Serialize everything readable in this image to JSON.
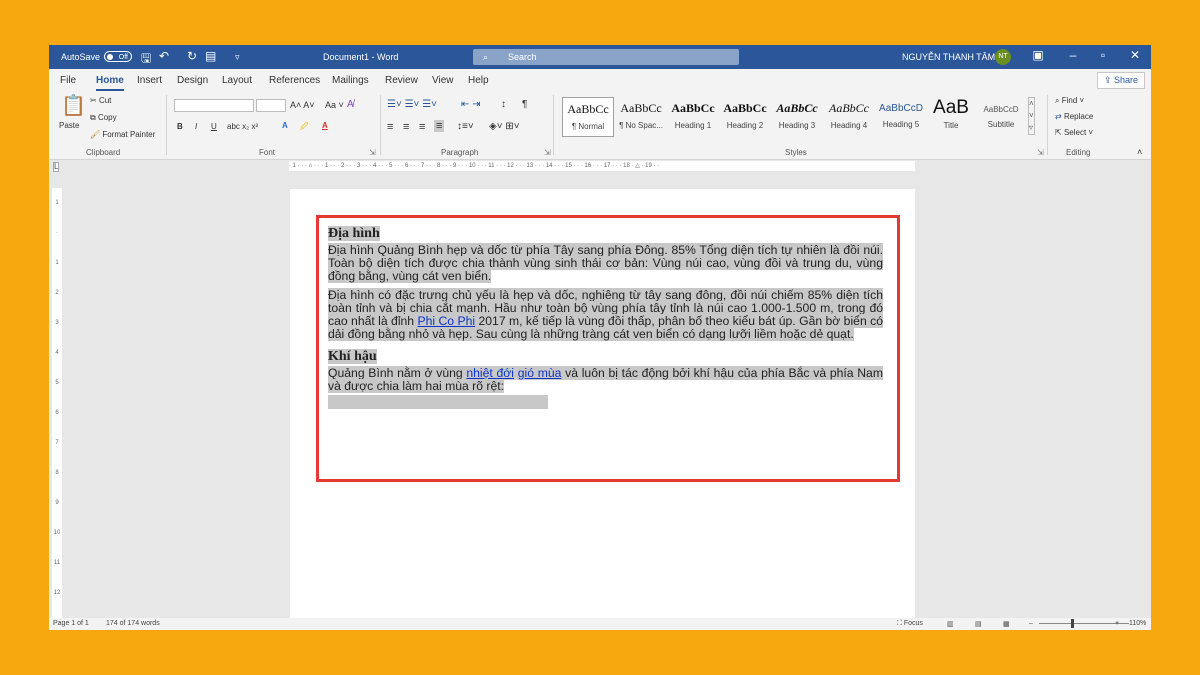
{
  "titlebar": {
    "autosave": "AutoSave",
    "autosave_state": "Off",
    "doc_title": "Document1  -  Word",
    "search_placeholder": "Search",
    "user_name": "NGUYỄN THANH TÂM",
    "user_initials": "NT"
  },
  "tabs": [
    "File",
    "Home",
    "Insert",
    "Design",
    "Layout",
    "References",
    "Mailings",
    "Review",
    "View",
    "Help"
  ],
  "share_label": "Share",
  "clipboard": {
    "paste": "Paste",
    "cut": "Cut",
    "copy": "Copy",
    "format_painter": "Format Painter",
    "group": "Clipboard"
  },
  "font": {
    "group": "Font",
    "bold": "B",
    "italic": "I",
    "underline": "U"
  },
  "paragraph": {
    "group": "Paragraph"
  },
  "styles": {
    "group": "Styles",
    "items": [
      {
        "preview": "AaBbCc",
        "name": "¶ Normal"
      },
      {
        "preview": "AaBbCc",
        "name": "¶ No Spac..."
      },
      {
        "preview": "AaBbCc",
        "name": "Heading 1"
      },
      {
        "preview": "AaBbCc",
        "name": "Heading 2"
      },
      {
        "preview": "AaBbCc",
        "name": "Heading 3"
      },
      {
        "preview": "AaBbCc",
        "name": "Heading 4"
      },
      {
        "preview": "AaBbCcD",
        "name": "Heading 5"
      },
      {
        "preview": "AaB",
        "name": "Title"
      },
      {
        "preview": "AaBbCcD",
        "name": "Subtitle"
      }
    ]
  },
  "editing": {
    "find": "Find",
    "replace": "Replace",
    "select": "Select",
    "group": "Editing"
  },
  "document": {
    "heading1": "Địa hình",
    "para1": "Địa hình Quảng Bình hẹp và dốc từ phía Tây sang phía Đông. 85% Tổng diện tích tự nhiên là đồi núi. Toàn bộ diện tích được chia thành vùng sinh thái cơ bản: Vùng núi cao, vùng đồi và trung du, vùng đồng bằng, vùng cát ven biển.",
    "para2_a": "Địa hình có đặc trưng chủ yếu là hẹp và dốc, nghiêng từ tây sang đông, đồi núi chiếm 85% diện tích toàn tỉnh và bị chia cắt mạnh. Hầu như toàn bộ vùng phía tây tỉnh là núi cao 1.000-1.500 m, trong đó cao nhất là đỉnh ",
    "para2_link": "Phi Co Phi",
    "para2_b": " 2017 m, kế tiếp là vùng đồi thấp, phân bố theo kiểu bát úp. Gần bờ biển có dải đồng bằng nhỏ và hẹp. Sau cùng là những tràng cát ven biển có dạng lưỡi liềm hoặc dẻ quạt.",
    "heading2": "Khí hậu",
    "para3_a": "Quảng Bình nằm ở vùng ",
    "para3_link1": "nhiệt đới",
    "para3_link2": "gió mùa",
    "para3_b": " và luôn bị tác động bởi khí hậu của phía Bắc và phía Nam và được chia làm hai mùa rõ rệt:"
  },
  "status": {
    "page": "Page 1 of 1",
    "words": "174 of 174 words",
    "focus": "Focus",
    "zoom": "110%"
  },
  "colors": {
    "title_bar": "#2b579a",
    "background": "#f7a80e",
    "highlight_box": "#e53935"
  }
}
